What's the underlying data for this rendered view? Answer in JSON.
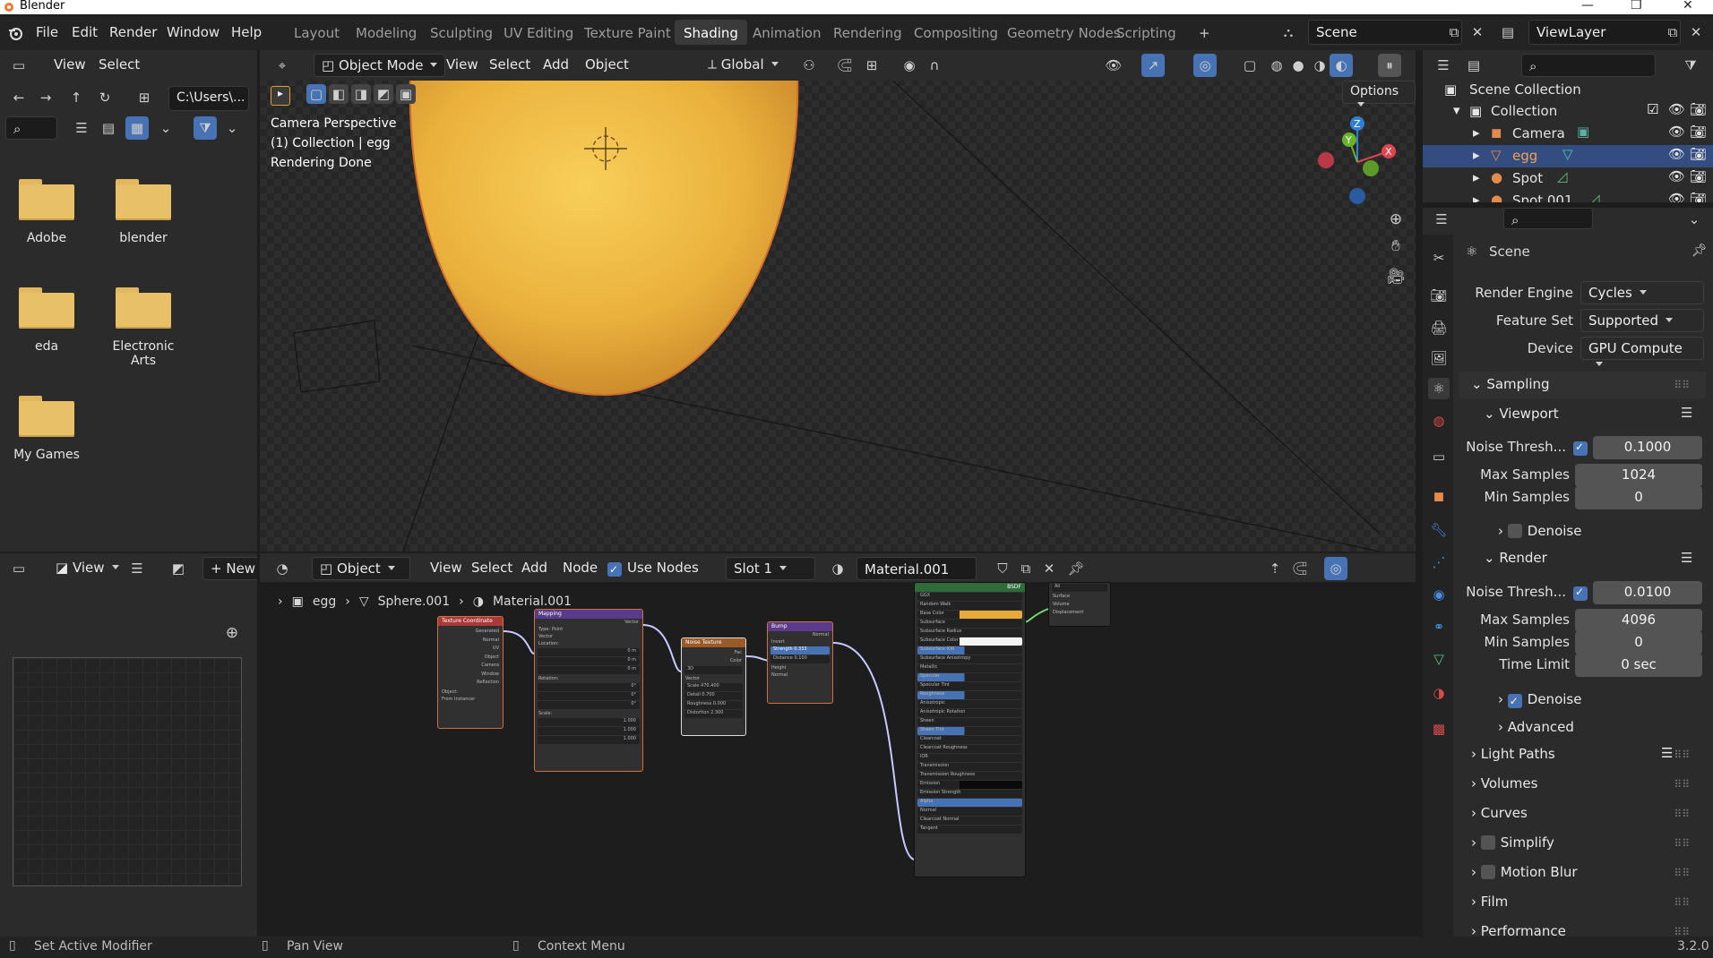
{
  "window": {
    "title": "Blender"
  },
  "menu": [
    "File",
    "Edit",
    "Render",
    "Window",
    "Help"
  ],
  "workspaces": [
    "Layout",
    "Modeling",
    "Sculpting",
    "UV Editing",
    "Texture Paint",
    "Shading",
    "Animation",
    "Rendering",
    "Compositing",
    "Geometry Nodes",
    "Scripting"
  ],
  "active_workspace": "Shading",
  "scene": {
    "name": "Scene",
    "view_layer": "ViewLayer"
  },
  "file_browser": {
    "menu": [
      "View",
      "Select"
    ],
    "path": "C:\\Users\\...",
    "folders": [
      "Adobe",
      "blender",
      "eda",
      "Electronic Arts",
      "My Games"
    ]
  },
  "viewport": {
    "mode": "Object Mode",
    "menus": [
      "View",
      "Select",
      "Add",
      "Object"
    ],
    "orientation": "Global",
    "options": "Options",
    "overlay_lines": [
      "Camera Perspective",
      "(1) Collection | egg",
      "Rendering Done"
    ],
    "gizmo_labels": {
      "z": "Z",
      "y": "Y",
      "x": "X"
    }
  },
  "image_editor": {
    "view": "View",
    "new": "New"
  },
  "node_editor": {
    "type": "Object",
    "menus": [
      "View",
      "Select",
      "Add",
      "Node"
    ],
    "use_nodes": "Use Nodes",
    "slot": "Slot 1",
    "material": "Material.001",
    "breadcrumb": [
      "egg",
      "Sphere.001",
      "Material.001"
    ],
    "nodes": {
      "texcoord": {
        "title": "Texture Coordinate",
        "outputs": [
          "Generated",
          "Normal",
          "UV",
          "Object",
          "Camera",
          "Window",
          "Reflection"
        ],
        "object_label": "Object:",
        "from_instancer": "From Instancer"
      },
      "mapping": {
        "title": "Mapping",
        "out": "Vector",
        "type_label": "Type:",
        "type_value": "Point",
        "vector": "Vector",
        "location": "Location:",
        "rotation": "Rotation:",
        "scale": "Scale:",
        "loc": [
          "0 m",
          "0 m",
          "0 m"
        ],
        "rot": [
          "0°",
          "0°",
          "0°"
        ],
        "scl": [
          "1.000",
          "1.000",
          "1.000"
        ]
      },
      "noise": {
        "title": "Noise Texture",
        "outputs": [
          "Fac",
          "Color"
        ],
        "dim": "3D",
        "vector": "Vector",
        "fields": [
          [
            "Scale",
            "470.400"
          ],
          [
            "Detail",
            "0.700"
          ],
          [
            "Roughness",
            "0.000"
          ],
          [
            "Distortion",
            "2.300"
          ]
        ]
      },
      "bump": {
        "title": "Bump",
        "out": "Normal",
        "invert": "Invert",
        "fields": [
          [
            "Strength",
            "0.333"
          ],
          [
            "Distance",
            "0.100"
          ]
        ],
        "inputs": [
          "Height",
          "Normal"
        ]
      },
      "bsdf": {
        "title": "BSDF",
        "dist": "GGX",
        "sss": "Random Walk",
        "rows": [
          "Base Color",
          "Subsurface",
          "Subsurface Radius",
          "Subsurface Color",
          "Subsurface IOR",
          "Subsurface Anisotropy",
          "Metallic",
          "Specular",
          "Specular Tint",
          "Roughness",
          "Anisotropic",
          "Anisotropic Rotation",
          "Sheen",
          "Sheen Tint",
          "Clearcoat",
          "Clearcoat Roughness",
          "IOR",
          "Transmission",
          "Transmission Roughness",
          "Emission",
          "Emission Strength",
          "Alpha",
          "Normal",
          "Clearcoat Normal",
          "Tangent"
        ]
      },
      "output": {
        "title": "All",
        "rows": [
          "Surface",
          "Volume",
          "Displacement"
        ]
      }
    }
  },
  "outliner": {
    "root": "Scene Collection",
    "collection": "Collection",
    "items": [
      "Camera",
      "egg",
      "Spot",
      "Spot.001"
    ]
  },
  "properties": {
    "title": "Scene",
    "render_engine": {
      "label": "Render Engine",
      "value": "Cycles"
    },
    "feature_set": {
      "label": "Feature Set",
      "value": "Supported"
    },
    "device": {
      "label": "Device",
      "value": "GPU Compute"
    },
    "sampling": "Sampling",
    "viewport": {
      "title": "Viewport",
      "noise_label": "Noise Thresh...",
      "noise": "0.1000",
      "max_label": "Max Samples",
      "max": "1024",
      "min_label": "Min Samples",
      "min": "0",
      "denoise": "Denoise"
    },
    "render": {
      "title": "Render",
      "noise_label": "Noise Thresh...",
      "noise": "0.0100",
      "max_label": "Max Samples",
      "max": "4096",
      "min_label": "Min Samples",
      "min": "0",
      "time_label": "Time Limit",
      "time": "0 sec",
      "denoise": "Denoise",
      "advanced": "Advanced"
    },
    "sections": [
      "Light Paths",
      "Volumes",
      "Curves",
      "Simplify",
      "Motion Blur",
      "Film",
      "Performance"
    ]
  },
  "status": {
    "left": "Set Active Modifier",
    "mid": "Pan View",
    "right": "Context Menu",
    "version": "3.2.0"
  },
  "colors": {
    "accent": "#4772b3",
    "selected_row": "#334d80",
    "egg": "#e8ab3a",
    "folder": "#e7c067"
  }
}
